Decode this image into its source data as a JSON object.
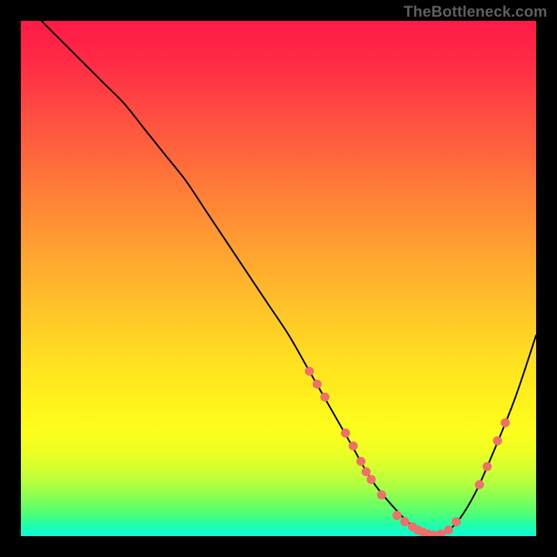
{
  "watermark": "TheBottleneck.com",
  "chart_data": {
    "type": "line",
    "title": "",
    "xlabel": "",
    "ylabel": "",
    "xlim": [
      0,
      100
    ],
    "ylim": [
      0,
      100
    ],
    "grid": false,
    "legend": false,
    "note": "Values estimated from pixel positions; vertical axis is inverted (higher pixel y = lower value). x and y normalized to 0-100 range of plot area.",
    "curve": {
      "name": "bottleneck-curve",
      "x": [
        4,
        8,
        12,
        16,
        20,
        24,
        28,
        32,
        36,
        40,
        44,
        48,
        52,
        56,
        60,
        64,
        68,
        72,
        76,
        80,
        84,
        88,
        92,
        96,
        100
      ],
      "y": [
        100,
        96,
        92,
        88,
        84,
        79,
        74,
        69,
        63,
        57,
        51,
        45,
        39,
        32,
        25,
        18,
        11,
        6,
        2,
        0,
        2,
        8,
        17,
        27,
        39
      ]
    },
    "markers": {
      "name": "highlighted-points",
      "color": "#ef6f6b",
      "points": [
        {
          "x": 56.0,
          "y": 32.0
        },
        {
          "x": 57.5,
          "y": 29.5
        },
        {
          "x": 59.0,
          "y": 27.0
        },
        {
          "x": 63.0,
          "y": 20.0
        },
        {
          "x": 64.5,
          "y": 17.5
        },
        {
          "x": 66.0,
          "y": 14.5
        },
        {
          "x": 67.0,
          "y": 12.5
        },
        {
          "x": 68.0,
          "y": 11.0
        },
        {
          "x": 70.0,
          "y": 8.0
        },
        {
          "x": 73.0,
          "y": 4.0
        },
        {
          "x": 74.5,
          "y": 2.8
        },
        {
          "x": 76.0,
          "y": 1.8
        },
        {
          "x": 77.0,
          "y": 1.2
        },
        {
          "x": 78.0,
          "y": 0.8
        },
        {
          "x": 79.0,
          "y": 0.4
        },
        {
          "x": 80.0,
          "y": 0.2
        },
        {
          "x": 81.5,
          "y": 0.4
        },
        {
          "x": 83.0,
          "y": 1.2
        },
        {
          "x": 84.5,
          "y": 2.8
        },
        {
          "x": 89.0,
          "y": 10.0
        },
        {
          "x": 90.5,
          "y": 13.5
        },
        {
          "x": 92.5,
          "y": 18.5
        },
        {
          "x": 94.0,
          "y": 22.0
        }
      ]
    }
  }
}
